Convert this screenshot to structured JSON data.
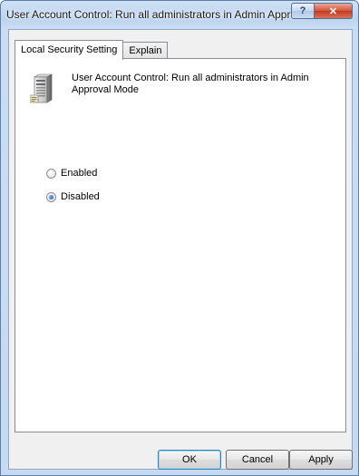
{
  "window": {
    "title": "User Account Control: Run all administrators in Admin Approval...",
    "help_glyph": "?",
    "close_glyph": "✕"
  },
  "tabs": [
    {
      "label": "Local Security Setting",
      "active": true
    },
    {
      "label": "Explain",
      "active": false
    }
  ],
  "policy": {
    "name": "User Account Control: Run all administrators in Admin Approval Mode",
    "icon": "server-policy-icon"
  },
  "options": [
    {
      "label": "Enabled",
      "selected": false
    },
    {
      "label": "Disabled",
      "selected": true
    }
  ],
  "buttons": {
    "ok": "OK",
    "cancel": "Cancel",
    "apply": "Apply"
  },
  "colors": {
    "titlebar": "#c6daf2",
    "close_button": "#c7402a",
    "default_button_border": "#3c7fb1"
  }
}
